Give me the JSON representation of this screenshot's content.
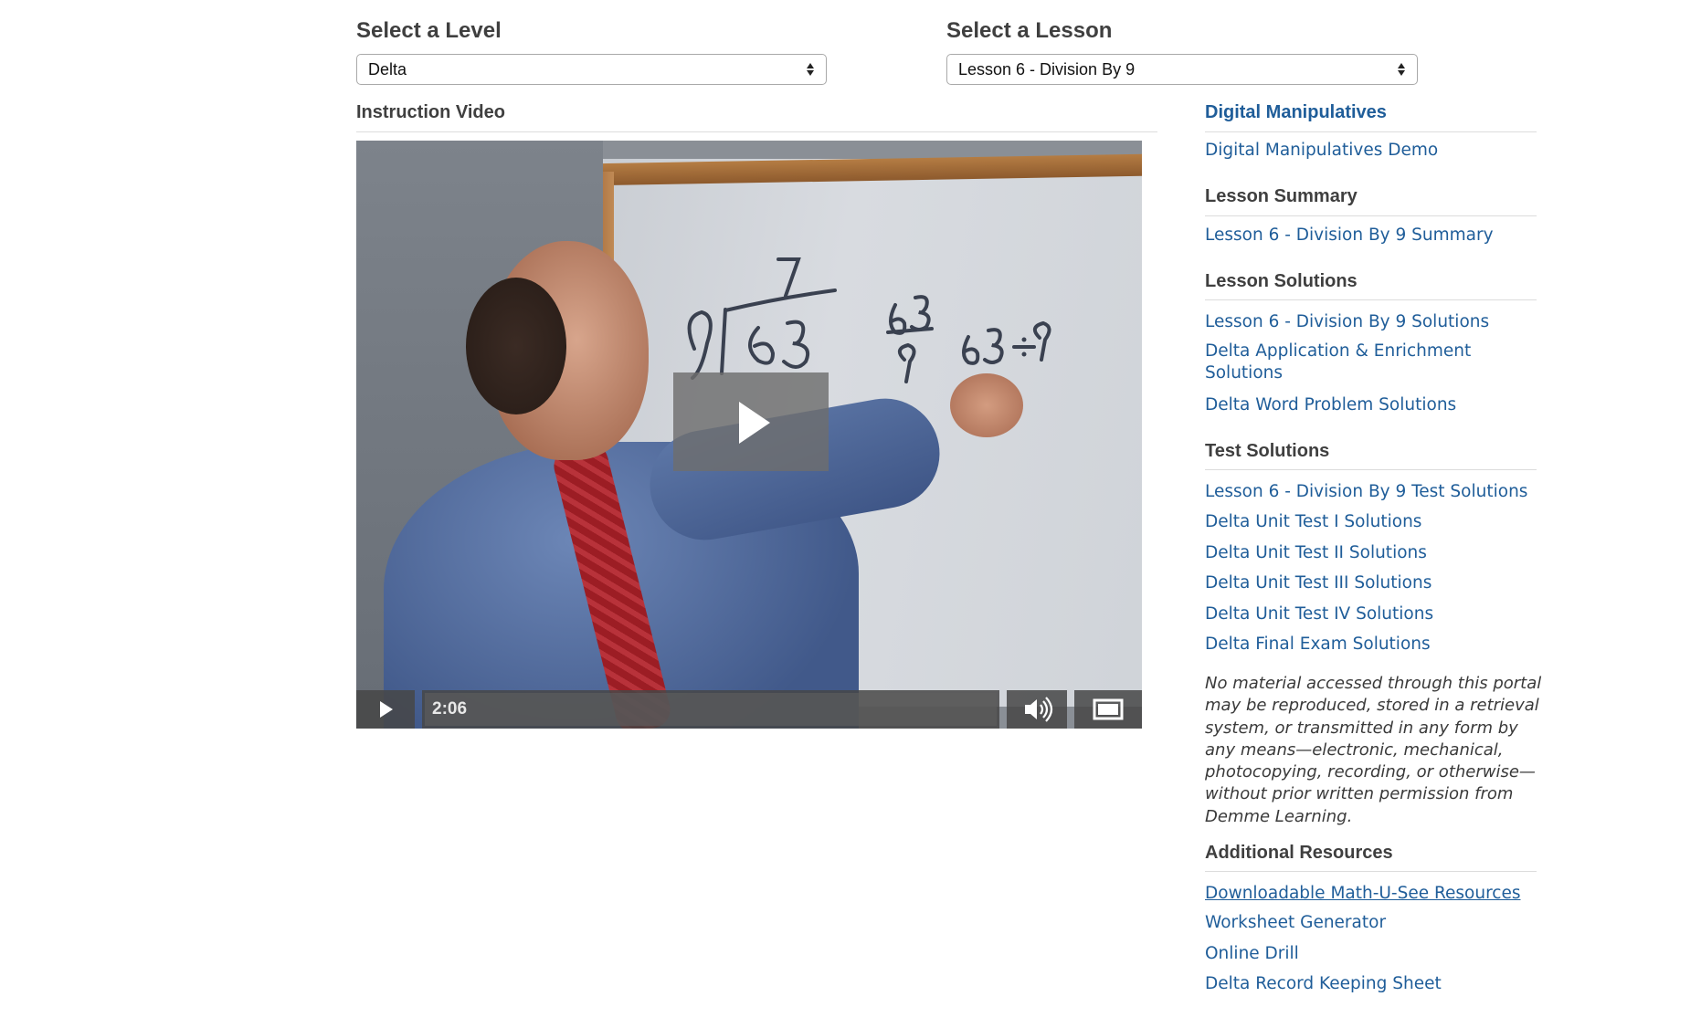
{
  "level": {
    "heading": "Select a Level",
    "selected": "Delta"
  },
  "lesson": {
    "heading": "Select a Lesson",
    "selected": "Lesson 6 - Division By 9"
  },
  "video": {
    "heading": "Instruction Video",
    "time": "2:06",
    "icons": [
      "play-icon",
      "volume-icon",
      "fullscreen-icon"
    ]
  },
  "sidebar": {
    "digital_manipulatives": {
      "heading": "Digital Manipulatives",
      "links": [
        "Digital Manipulatives Demo"
      ]
    },
    "lesson_summary": {
      "heading": "Lesson Summary",
      "links": [
        "Lesson 6 - Division By 9 Summary"
      ]
    },
    "lesson_solutions": {
      "heading": "Lesson Solutions",
      "links": [
        "Lesson 6 - Division By 9 Solutions",
        "Delta Application & Enrichment",
        "Solutions",
        "Delta Word Problem Solutions"
      ]
    },
    "test_solutions": {
      "heading": "Test Solutions",
      "links": [
        "Lesson 6 - Division By 9 Test Solutions",
        "Delta Unit Test I Solutions",
        "Delta Unit Test II Solutions",
        "Delta Unit Test III Solutions",
        "Delta Unit Test IV Solutions",
        "Delta Final Exam Solutions"
      ]
    },
    "notice": "No material accessed through this portal may be reproduced, stored in a retrieval system, or transmitted in any form by any means—electronic, mechanical, photocopying, recording, or otherwise—without prior written permission from Demme Learning.",
    "additional_resources": {
      "heading": "Additional Resources",
      "links": [
        "Downloadable Math-U-See Resources",
        "Worksheet Generator",
        "Online Drill",
        "Delta Record Keeping Sheet"
      ]
    }
  },
  "colors": {
    "link": "#1f5d99",
    "heading_blue": "#1f5d99",
    "heading_gray": "#3f3f3f"
  }
}
